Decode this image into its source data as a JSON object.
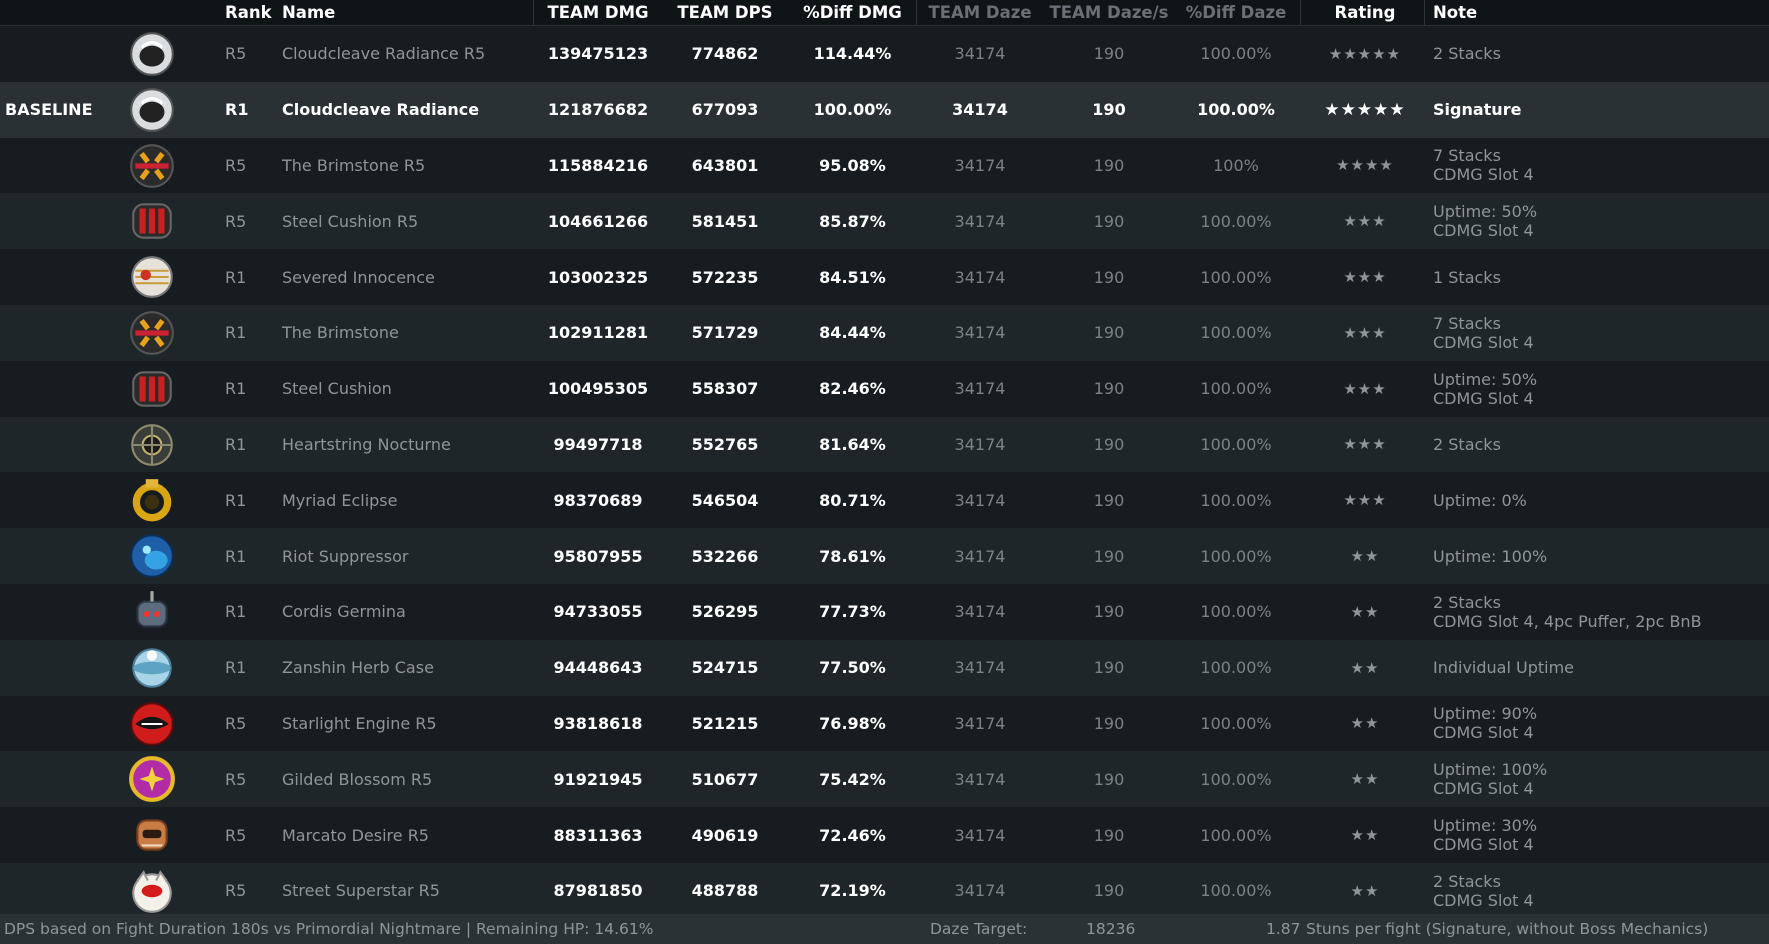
{
  "header": {
    "rank": "Rank",
    "name": "Name",
    "team_dmg": "TEAM DMG",
    "team_dps": "TEAM DPS",
    "diff_dmg": "%Diff DMG",
    "team_daze": "TEAM Daze",
    "team_daze_s": "TEAM Daze/s",
    "diff_daze": "%Diff Daze",
    "rating": "Rating",
    "note": "Note"
  },
  "rows": [
    {
      "tag": "",
      "icon": "astronaut-helmet-icon",
      "rank": "R5",
      "name": "Cloudcleave Radiance R5",
      "dmg": "139475123",
      "dps": "774862",
      "pdmg": "114.44%",
      "daze": "34174",
      "dazes": "190",
      "pdaze": "100.00%",
      "rating": "★★★★★",
      "note1": "2 Stacks",
      "note2": ""
    },
    {
      "tag": "BASELINE",
      "icon": "astronaut-helmet-icon",
      "rank": "R1",
      "name": "Cloudcleave Radiance",
      "dmg": "121876682",
      "dps": "677093",
      "pdmg": "100.00%",
      "daze": "34174",
      "dazes": "190",
      "pdaze": "100.00%",
      "rating": "★★★★★",
      "note1": "Signature",
      "note2": ""
    },
    {
      "tag": "",
      "icon": "brimstone-sphere-icon",
      "rank": "R5",
      "name": "The Brimstone R5",
      "dmg": "115884216",
      "dps": "643801",
      "pdmg": "95.08%",
      "daze": "34174",
      "dazes": "190",
      "pdaze": "100%",
      "rating": "★★★★",
      "note1": "7 Stacks",
      "note2": "CDMG Slot 4"
    },
    {
      "tag": "",
      "icon": "red-drum-icon",
      "rank": "R5",
      "name": "Steel Cushion R5",
      "dmg": "104661266",
      "dps": "581451",
      "pdmg": "85.87%",
      "daze": "34174",
      "dazes": "190",
      "pdaze": "100.00%",
      "rating": "★★★",
      "note1": "Uptime: 50%",
      "note2": "CDMG Slot 4"
    },
    {
      "tag": "",
      "icon": "white-shell-icon",
      "rank": "R1",
      "name": "Severed Innocence",
      "dmg": "103002325",
      "dps": "572235",
      "pdmg": "84.51%",
      "daze": "34174",
      "dazes": "190",
      "pdaze": "100.00%",
      "rating": "★★★",
      "note1": "1 Stacks",
      "note2": ""
    },
    {
      "tag": "",
      "icon": "brimstone-sphere-icon",
      "rank": "R1",
      "name": "The Brimstone",
      "dmg": "102911281",
      "dps": "571729",
      "pdmg": "84.44%",
      "daze": "34174",
      "dazes": "190",
      "pdaze": "100.00%",
      "rating": "★★★",
      "note1": "7 Stacks",
      "note2": "CDMG Slot 4"
    },
    {
      "tag": "",
      "icon": "red-drum-icon",
      "rank": "R1",
      "name": "Steel Cushion",
      "dmg": "100495305",
      "dps": "558307",
      "pdmg": "82.46%",
      "daze": "34174",
      "dazes": "190",
      "pdaze": "100.00%",
      "rating": "★★★",
      "note1": "Uptime: 50%",
      "note2": "CDMG Slot 4"
    },
    {
      "tag": "",
      "icon": "orb-cage-icon",
      "rank": "R1",
      "name": "Heartstring Nocturne",
      "dmg": "99497718",
      "dps": "552765",
      "pdmg": "81.64%",
      "daze": "34174",
      "dazes": "190",
      "pdaze": "100.00%",
      "rating": "★★★",
      "note1": "2 Stacks",
      "note2": ""
    },
    {
      "tag": "",
      "icon": "gold-ring-icon",
      "rank": "R1",
      "name": "Myriad Eclipse",
      "dmg": "98370689",
      "dps": "546504",
      "pdmg": "80.71%",
      "daze": "34174",
      "dazes": "190",
      "pdaze": "100.00%",
      "rating": "★★★",
      "note1": "Uptime: 0%",
      "note2": ""
    },
    {
      "tag": "",
      "icon": "blue-creature-icon",
      "rank": "R1",
      "name": "Riot Suppressor",
      "dmg": "95807955",
      "dps": "532266",
      "pdmg": "78.61%",
      "daze": "34174",
      "dazes": "190",
      "pdaze": "100.00%",
      "rating": "★★",
      "note1": "Uptime: 100%",
      "note2": ""
    },
    {
      "tag": "",
      "icon": "robot-head-icon",
      "rank": "R1",
      "name": "Cordis Germina",
      "dmg": "94733055",
      "dps": "526295",
      "pdmg": "77.73%",
      "daze": "34174",
      "dazes": "190",
      "pdaze": "100.00%",
      "rating": "★★",
      "note1": "2 Stacks",
      "note2": "CDMG Slot 4, 4pc Puffer, 2pc BnB"
    },
    {
      "tag": "",
      "icon": "herb-case-icon",
      "rank": "R1",
      "name": "Zanshin Herb Case",
      "dmg": "94448643",
      "dps": "524715",
      "pdmg": "77.50%",
      "daze": "34174",
      "dazes": "190",
      "pdaze": "100.00%",
      "rating": "★★",
      "note1": "Individual Uptime",
      "note2": ""
    },
    {
      "tag": "",
      "icon": "red-helmet-icon",
      "rank": "R5",
      "name": "Starlight Engine R5",
      "dmg": "93818618",
      "dps": "521215",
      "pdmg": "76.98%",
      "daze": "34174",
      "dazes": "190",
      "pdaze": "100.00%",
      "rating": "★★",
      "note1": "Uptime: 90%",
      "note2": "CDMG Slot 4"
    },
    {
      "tag": "",
      "icon": "blossom-ball-icon",
      "rank": "R5",
      "name": "Gilded Blossom R5",
      "dmg": "91921945",
      "dps": "510677",
      "pdmg": "75.42%",
      "daze": "34174",
      "dazes": "190",
      "pdaze": "100.00%",
      "rating": "★★",
      "note1": "Uptime: 100%",
      "note2": "CDMG Slot 4"
    },
    {
      "tag": "",
      "icon": "mask-device-icon",
      "rank": "R5",
      "name": "Marcato Desire R5",
      "dmg": "88311363",
      "dps": "490619",
      "pdmg": "72.46%",
      "daze": "34174",
      "dazes": "190",
      "pdaze": "100.00%",
      "rating": "★★",
      "note1": "Uptime: 30%",
      "note2": "CDMG Slot 4"
    },
    {
      "tag": "",
      "icon": "white-cat-icon",
      "rank": "R5",
      "name": "Street Superstar R5",
      "dmg": "87981850",
      "dps": "488788",
      "pdmg": "72.19%",
      "daze": "34174",
      "dazes": "190",
      "pdaze": "100.00%",
      "rating": "★★",
      "note1": "2 Stacks",
      "note2": "CDMG Slot 4"
    }
  ],
  "footer": {
    "left": "DPS based on Fight Duration 180s vs Primordial Nightmare | Remaining HP: 14.61%",
    "daze_label": "Daze Target:",
    "daze_value": "18236",
    "stuns_value": "1.87",
    "stuns_label": "Stuns per fight (Signature, without Boss Mechanics)"
  }
}
